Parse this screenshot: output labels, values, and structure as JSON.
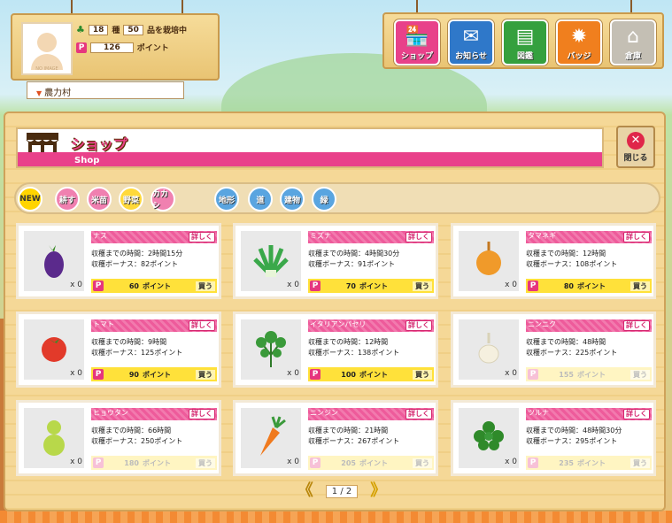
{
  "status": {
    "seed_kinds": "18",
    "seed_label": "種",
    "seed_total": "50",
    "seed_suffix": "品を栽培中",
    "points": "126",
    "points_label": "ポイント",
    "avatar_caption": "NO IMAGE",
    "village": "農力村"
  },
  "nav": [
    {
      "label": "ショップ",
      "icon": "shop-icon",
      "color": "#e8418a"
    },
    {
      "label": "お知らせ",
      "icon": "mail-icon",
      "color": "#2f78c9"
    },
    {
      "label": "図鑑",
      "icon": "book-icon",
      "color": "#35a03e"
    },
    {
      "label": "バッジ",
      "icon": "badge-icon",
      "color": "#f07f1e"
    },
    {
      "label": "倉庫",
      "icon": "warehouse-icon",
      "color": "#c4bfb4"
    }
  ],
  "shop": {
    "title_jp": "ショップ",
    "title_en": "Shop",
    "close_label": "閉じる"
  },
  "categories": [
    {
      "label": "NEW",
      "color": "#ffd400",
      "text": "#333"
    },
    {
      "label": "耕す",
      "color": "#f080b0"
    },
    {
      "label": "米苗",
      "color": "#f080b0"
    },
    {
      "label": "野菜",
      "color": "#ffd93a"
    },
    {
      "label": "カカシ",
      "color": "#f080b0"
    },
    {
      "label": "地形",
      "color": "#5aa5e0"
    },
    {
      "label": "道",
      "color": "#5aa5e0"
    },
    {
      "label": "建物",
      "color": "#5aa5e0"
    },
    {
      "label": "緑",
      "color": "#5aa5e0"
    }
  ],
  "labels": {
    "detail": "詳しく",
    "time_prefix": "収穫までの時間：",
    "bonus_prefix": "収穫ボーナス：",
    "points_unit": "ポイント",
    "buy": "買う",
    "count_prefix": "x "
  },
  "items": [
    {
      "name": "ナス",
      "time": "2時間15分",
      "bonus": "82ポイント",
      "price": "60",
      "count": "0",
      "buyable": true,
      "art": "eggplant"
    },
    {
      "name": "ミズナ",
      "time": "4時間30分",
      "bonus": "91ポイント",
      "price": "70",
      "count": "0",
      "buyable": true,
      "art": "mizuna"
    },
    {
      "name": "タマネギ",
      "time": "12時間",
      "bonus": "108ポイント",
      "price": "80",
      "count": "0",
      "buyable": true,
      "art": "onion"
    },
    {
      "name": "トマト",
      "time": "9時間",
      "bonus": "125ポイント",
      "price": "90",
      "count": "0",
      "buyable": true,
      "art": "tomato"
    },
    {
      "name": "イタリアンパセリ",
      "time": "12時間",
      "bonus": "138ポイント",
      "price": "100",
      "count": "0",
      "buyable": true,
      "art": "parsley"
    },
    {
      "name": "ニンニク",
      "time": "48時間",
      "bonus": "225ポイント",
      "price": "155",
      "count": "0",
      "buyable": false,
      "art": "garlic"
    },
    {
      "name": "ヒョウタン",
      "time": "66時間",
      "bonus": "250ポイント",
      "price": "180",
      "count": "0",
      "buyable": false,
      "art": "gourd"
    },
    {
      "name": "ニンジン",
      "time": "21時間",
      "bonus": "267ポイント",
      "price": "205",
      "count": "0",
      "buyable": false,
      "art": "carrot"
    },
    {
      "name": "ツルナ",
      "time": "48時間30分",
      "bonus": "295ポイント",
      "price": "235",
      "count": "0",
      "buyable": false,
      "art": "tsuruna"
    }
  ],
  "pager": {
    "current": "1",
    "total": "2",
    "sep": "/"
  }
}
